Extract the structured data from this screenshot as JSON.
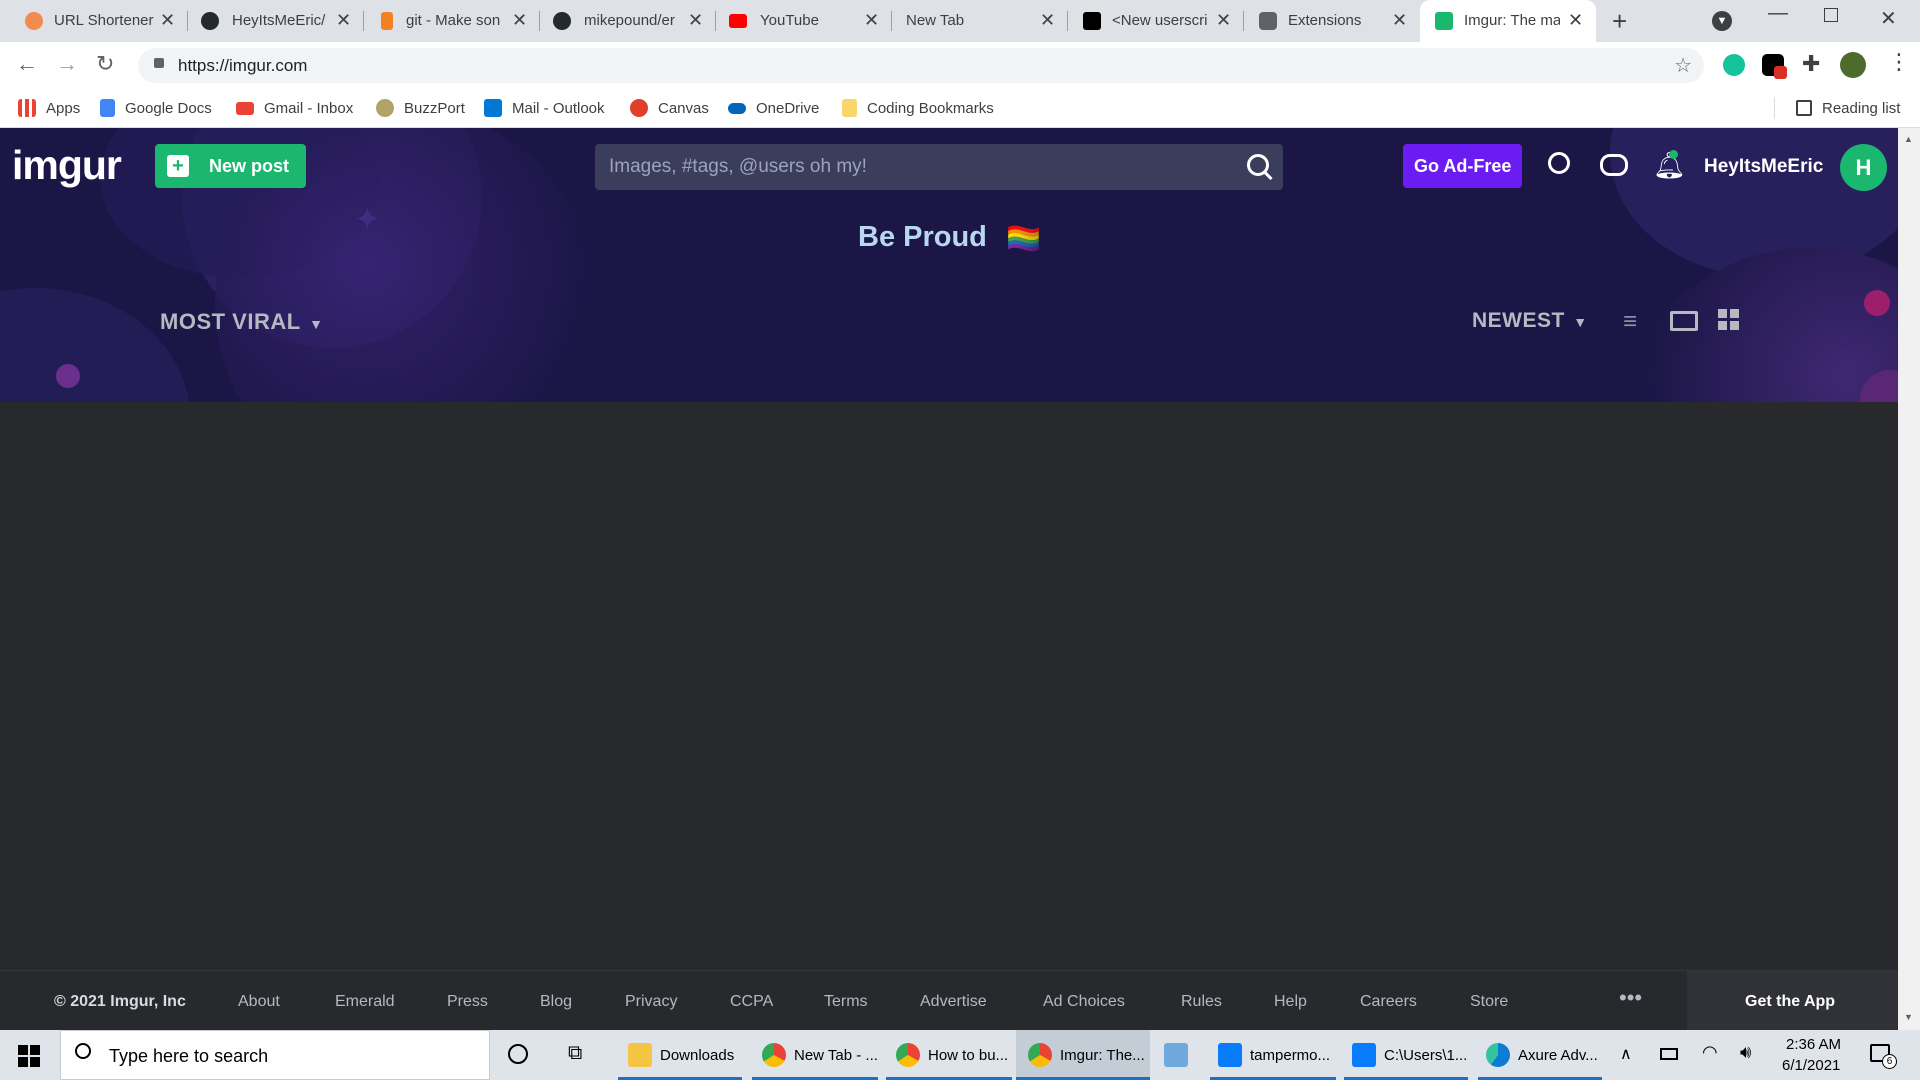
{
  "browser": {
    "tabs": [
      {
        "title": "URL Shortener",
        "icon": "url-shortener-favicon",
        "color": "#f28b50"
      },
      {
        "title": "HeyItsMeEric/",
        "icon": "github-icon",
        "color": "#24292e"
      },
      {
        "title": "git - Make son",
        "icon": "stackoverflow-icon",
        "color": "#f48024"
      },
      {
        "title": "mikepound/er",
        "icon": "github-icon",
        "color": "#24292e"
      },
      {
        "title": "YouTube",
        "icon": "youtube-icon",
        "color": "#ff0000"
      },
      {
        "title": "New Tab",
        "icon": "",
        "color": ""
      },
      {
        "title": "<New userscri",
        "icon": "tampermonkey-icon",
        "color": "#000000"
      },
      {
        "title": "Extensions",
        "icon": "puzzle-icon",
        "color": "#3c4043"
      },
      {
        "title": "Imgur: The ma",
        "icon": "imgur-favicon",
        "color": "#1bb76e",
        "active": true
      }
    ],
    "url": "https://imgur.com",
    "bookmarks": [
      {
        "label": "Apps",
        "icon": "apps-grid-icon",
        "color": "#4285f4"
      },
      {
        "label": "Google Docs",
        "icon": "google-docs-icon",
        "color": "#4285f4"
      },
      {
        "label": "Gmail - Inbox",
        "icon": "gmail-icon",
        "color": "#ea4335"
      },
      {
        "label": "BuzzPort",
        "icon": "buzzport-icon",
        "color": "#b3a369"
      },
      {
        "label": "Mail - Outlook",
        "icon": "outlook-icon",
        "color": "#0078d4"
      },
      {
        "label": "Canvas",
        "icon": "canvas-icon",
        "color": "#e13f2b"
      },
      {
        "label": "OneDrive",
        "icon": "onedrive-icon",
        "color": "#0364b8"
      },
      {
        "label": "Coding Bookmarks",
        "icon": "folder-icon",
        "color": "#f9d66b"
      }
    ],
    "reading_list": "Reading list"
  },
  "imgur": {
    "logo": "imgur",
    "new_post": "New post",
    "search_placeholder": "Images, #tags, @users oh my!",
    "go_ad_free": "Go Ad-Free",
    "username": "HeyItsMeEric",
    "avatar_letter": "H",
    "banner": "Be Proud",
    "banner_flag": "🏳️‍🌈",
    "section_left": "MOST VIRAL",
    "section_right": "NEWEST",
    "colors": {
      "bg": "#1b1646",
      "green": "#1bb76e",
      "purple": "#6a1cf2",
      "content": "#27292d"
    }
  },
  "footer": {
    "copyright": "© 2021 Imgur, Inc",
    "links": [
      "About",
      "Emerald",
      "Press",
      "Blog",
      "Privacy",
      "CCPA",
      "Terms",
      "Advertise",
      "Ad Choices",
      "Rules",
      "Help",
      "Careers",
      "Store"
    ],
    "more": "•••",
    "get_app": "Get the App"
  },
  "taskbar": {
    "search_placeholder": "Type here to search",
    "items": [
      {
        "label": "Downloads",
        "icon": "file-explorer-icon",
        "color": "#f4c542"
      },
      {
        "label": "New Tab - ...",
        "icon": "chrome-icon",
        "color": "#4285f4"
      },
      {
        "label": "How to bu...",
        "icon": "chrome-icon",
        "color": "#4285f4"
      },
      {
        "label": "Imgur: The...",
        "icon": "chrome-icon",
        "color": "#4285f4"
      },
      {
        "label": "",
        "icon": "paint-icon",
        "color": "#6fa8dc"
      },
      {
        "label": "tampermo...",
        "icon": "webstorm-icon",
        "color": "#087cfa"
      },
      {
        "label": "C:\\Users\\1...",
        "icon": "webstorm-icon",
        "color": "#087cfa"
      },
      {
        "label": "Axure Adv...",
        "icon": "edge-icon",
        "color": "#0c7cd5"
      }
    ],
    "time": "2:36 AM",
    "date": "6/1/2021",
    "notification_count": "6"
  }
}
